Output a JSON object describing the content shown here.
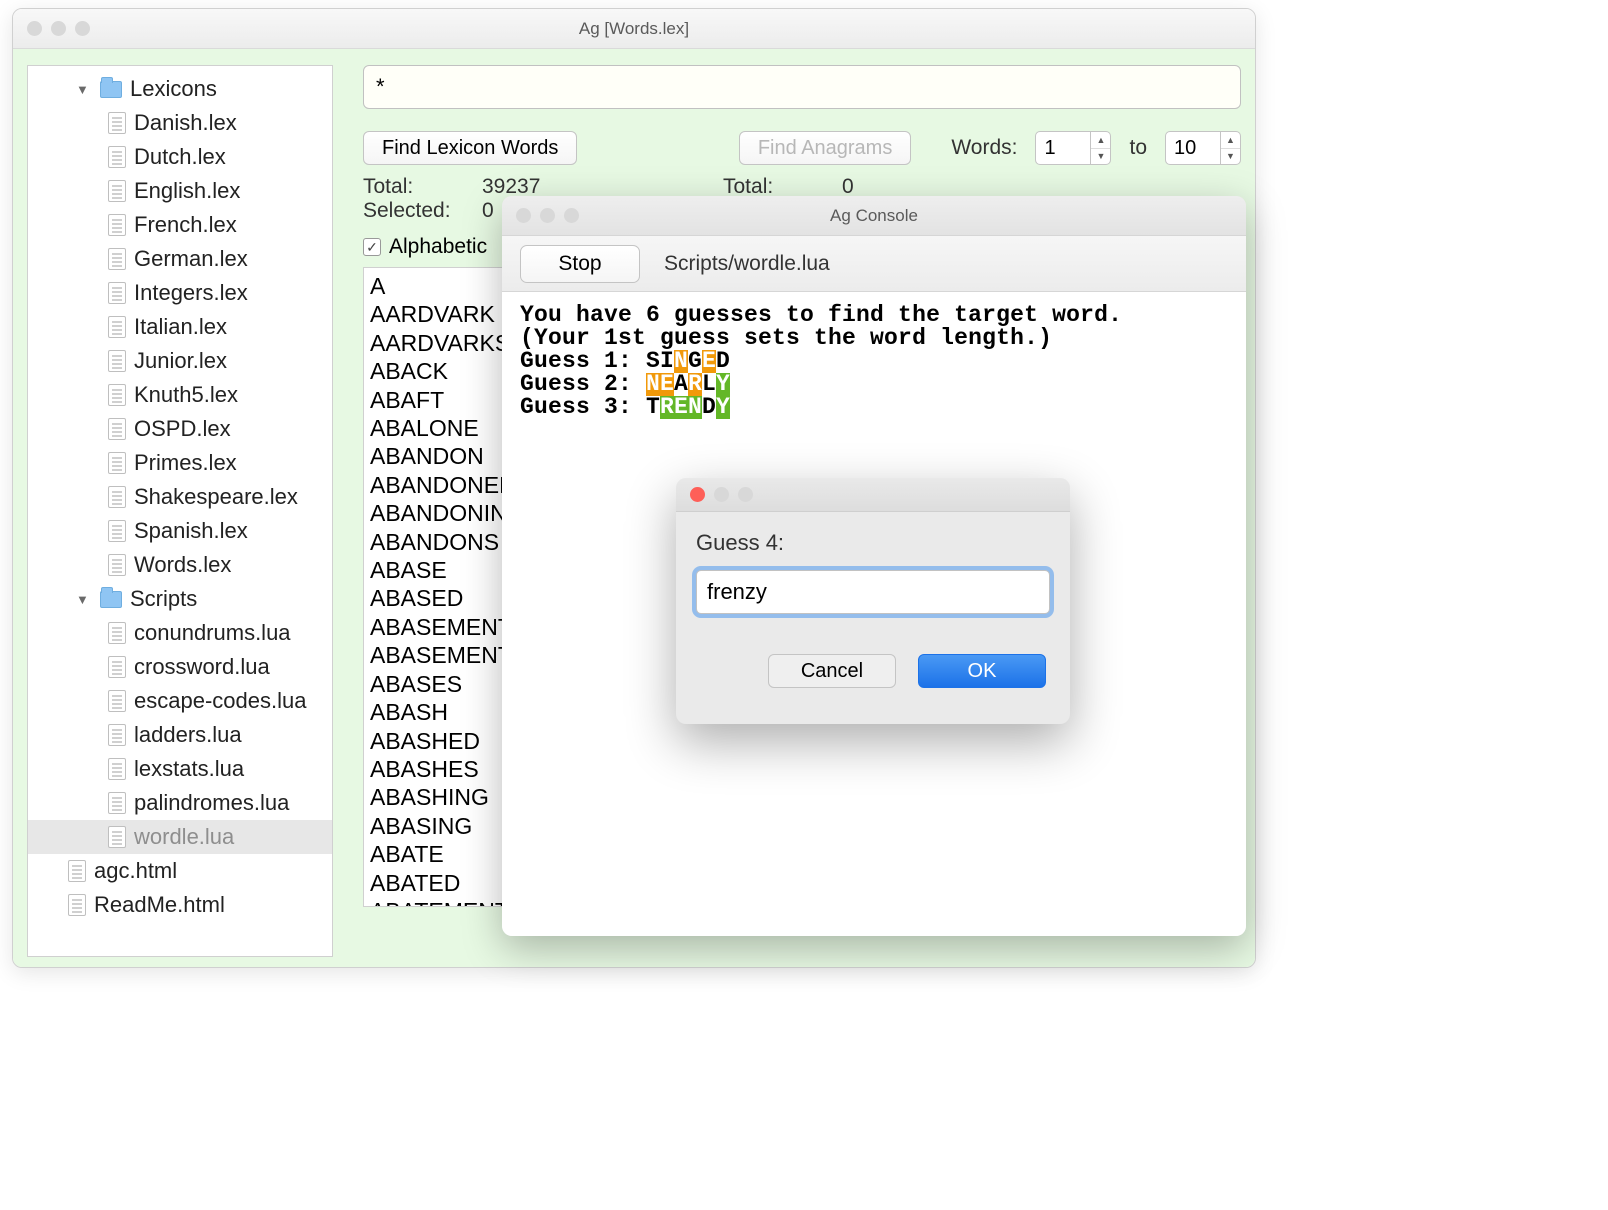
{
  "mainWindow": {
    "title": "Ag [Words.lex]"
  },
  "sidebar": {
    "groups": [
      {
        "name": "Lexicons",
        "kind": "folder",
        "expanded": true,
        "items": [
          "Danish.lex",
          "Dutch.lex",
          "English.lex",
          "French.lex",
          "German.lex",
          "Integers.lex",
          "Italian.lex",
          "Junior.lex",
          "Knuth5.lex",
          "OSPD.lex",
          "Primes.lex",
          "Shakespeare.lex",
          "Spanish.lex",
          "Words.lex"
        ]
      },
      {
        "name": "Scripts",
        "kind": "folder",
        "expanded": true,
        "items": [
          "conundrums.lua",
          "crossword.lua",
          "escape-codes.lua",
          "ladders.lua",
          "lexstats.lua",
          "palindromes.lua",
          "wordle.lua"
        ],
        "selected": "wordle.lua"
      }
    ],
    "rootFiles": [
      "agc.html",
      "ReadMe.html"
    ]
  },
  "right": {
    "search_value": "*",
    "find_lexicon_label": "Find Lexicon Words",
    "find_anagrams_label": "Find Anagrams",
    "words_label": "Words:",
    "to_label": "to",
    "words_min": "1",
    "words_max": "10",
    "lexicon_total_label": "Total:",
    "lexicon_total": "39237",
    "lexicon_selected_label": "Selected:",
    "lexicon_selected": "0",
    "anagram_total_label": "Total:",
    "anagram_total": "0",
    "alpha_label": "Alphabetic",
    "alpha_checked": true,
    "wordlist": [
      "A",
      "AARDVARK",
      "AARDVARKS",
      "ABACK",
      "ABAFT",
      "ABALONE",
      "ABANDON",
      "ABANDONED",
      "ABANDONING",
      "ABANDONS",
      "ABASE",
      "ABASED",
      "ABASEMENT",
      "ABASEMENTS",
      "ABASES",
      "ABASH",
      "ABASHED",
      "ABASHES",
      "ABASHING",
      "ABASING",
      "ABATE",
      "ABATED",
      "ABATEMENT"
    ]
  },
  "console": {
    "title": "Ag Console",
    "stop_label": "Stop",
    "script_path": "Scripts/wordle.lua",
    "intro1": "You have 6 guesses to find the target word.",
    "intro2": "(Your 1st guess sets the word length.)",
    "guesses": [
      {
        "n": 1,
        "prefix": "Guess 1: ",
        "letters": [
          {
            "c": "S",
            "t": "none"
          },
          {
            "c": "I",
            "t": "none"
          },
          {
            "c": "N",
            "t": "orange"
          },
          {
            "c": "G",
            "t": "none"
          },
          {
            "c": "E",
            "t": "orange"
          },
          {
            "c": "D",
            "t": "none"
          }
        ]
      },
      {
        "n": 2,
        "prefix": "Guess 2: ",
        "letters": [
          {
            "c": "N",
            "t": "orange"
          },
          {
            "c": "E",
            "t": "orange"
          },
          {
            "c": "A",
            "t": "none"
          },
          {
            "c": "R",
            "t": "orange"
          },
          {
            "c": "L",
            "t": "none"
          },
          {
            "c": "Y",
            "t": "green"
          }
        ]
      },
      {
        "n": 3,
        "prefix": "Guess 3: ",
        "letters": [
          {
            "c": "T",
            "t": "none"
          },
          {
            "c": "R",
            "t": "green"
          },
          {
            "c": "E",
            "t": "green"
          },
          {
            "c": "N",
            "t": "green"
          },
          {
            "c": "D",
            "t": "none"
          },
          {
            "c": "Y",
            "t": "green"
          }
        ]
      }
    ]
  },
  "dialog": {
    "prompt": "Guess 4:",
    "input_value": "frenzy",
    "cancel_label": "Cancel",
    "ok_label": "OK"
  }
}
